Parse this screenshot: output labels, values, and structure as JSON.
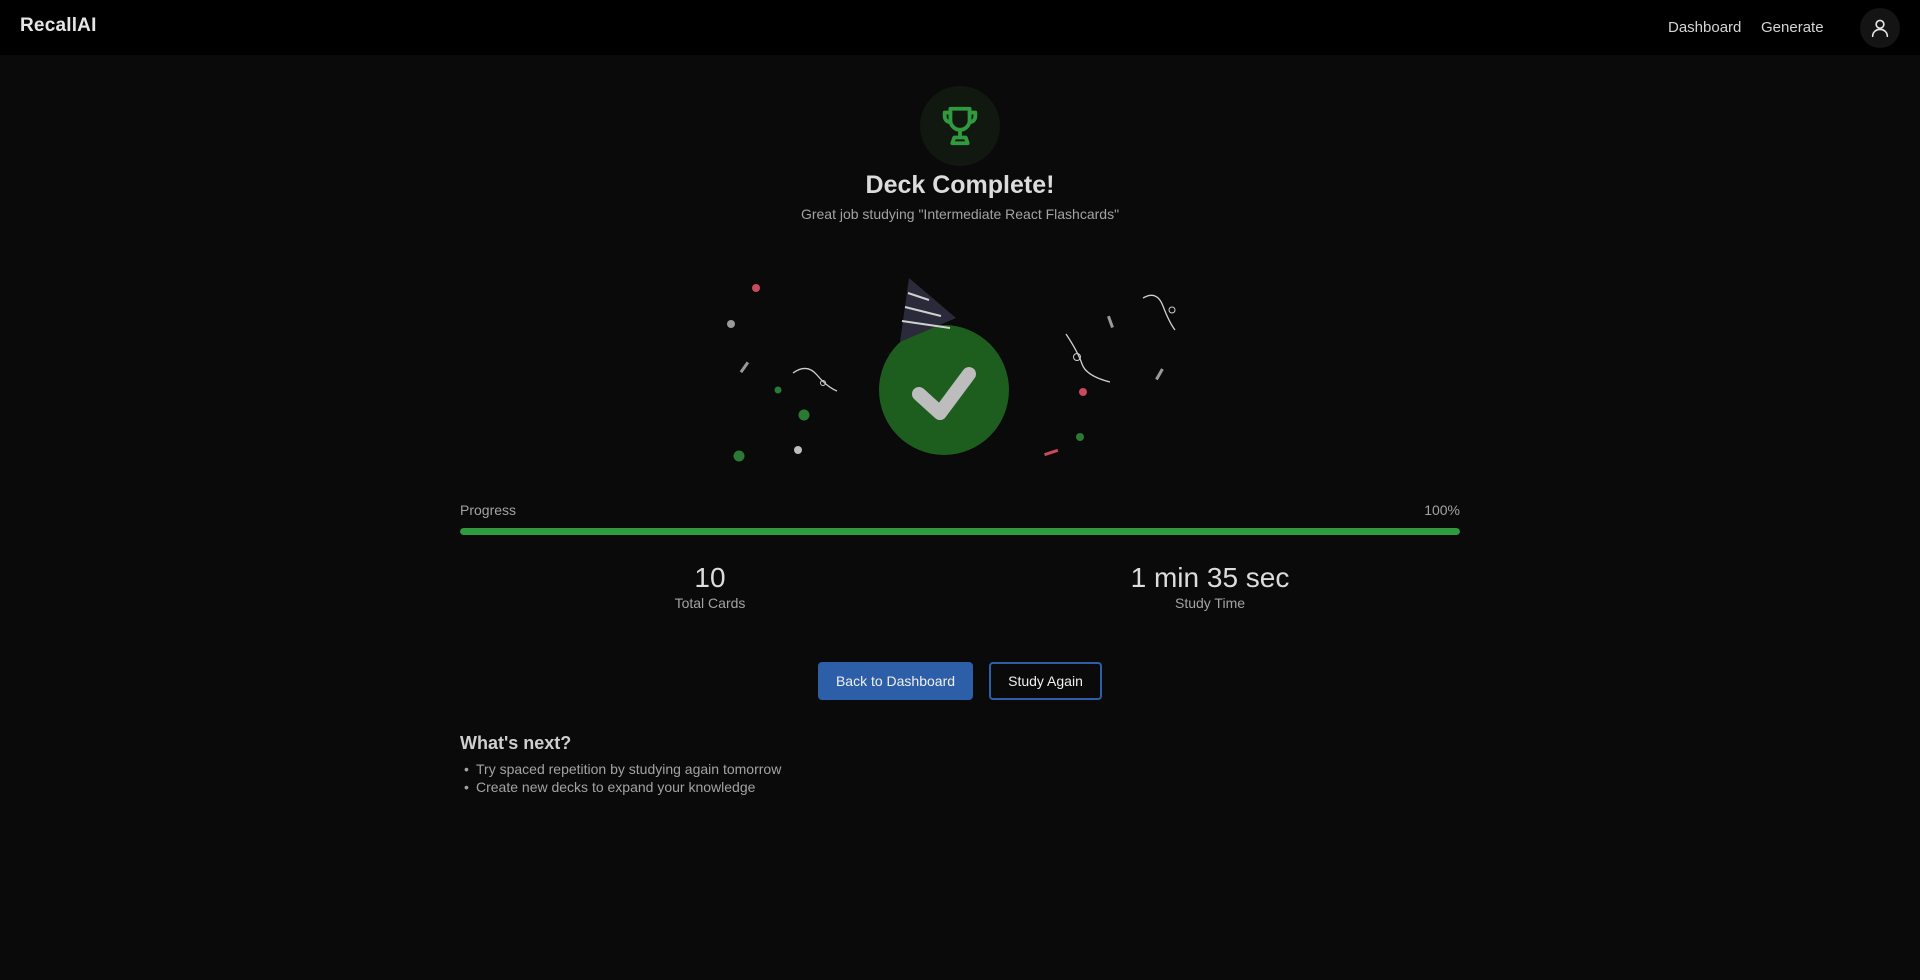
{
  "nav": {
    "brand": "RecallAI",
    "links": [
      "Dashboard",
      "Generate"
    ],
    "profile_icon": "user-icon"
  },
  "completion": {
    "badge_icon": "trophy-icon",
    "title": "Deck Complete!",
    "subtitle": "Great job studying \"Intermediate React Flashcards\"",
    "illustration_icon": "checkmark-party-icon"
  },
  "progress": {
    "label": "Progress",
    "percent_text": "100%",
    "value": 1.0
  },
  "stats": {
    "total_cards_value": "10",
    "total_cards_label": "Total Cards",
    "study_time_value": "1 min 35 sec",
    "study_time_label": "Study Time"
  },
  "actions": {
    "back_label": "Back to Dashboard",
    "again_label": "Study Again"
  },
  "next": {
    "title": "What's next?",
    "items": [
      "Try spaced repetition by studying again tomorrow",
      "Create new decks to expand your knowledge"
    ]
  },
  "colors": {
    "accent_green": "#2f9a3e",
    "accent_blue": "#2d5ea8",
    "background": "#0a0a0a"
  }
}
